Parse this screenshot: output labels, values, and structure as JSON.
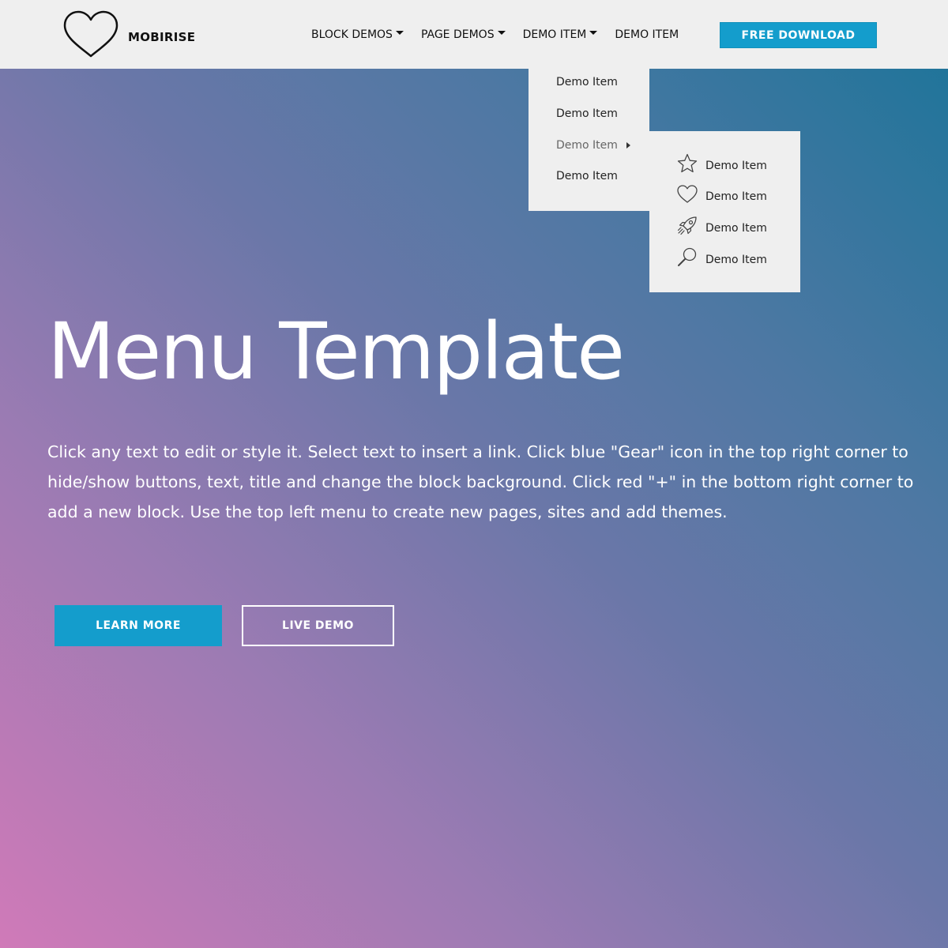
{
  "brand": {
    "name": "MOBIRISE",
    "logo_icon": "heart-icon"
  },
  "nav": {
    "items": [
      {
        "label": "BLOCK DEMOS",
        "has_caret": true
      },
      {
        "label": "PAGE DEMOS",
        "has_caret": true
      },
      {
        "label": "DEMO ITEM",
        "has_caret": true
      },
      {
        "label": "DEMO ITEM",
        "has_caret": false
      }
    ],
    "download_label": "FREE DOWNLOAD"
  },
  "dropdown": {
    "items": [
      {
        "label": "Demo Item"
      },
      {
        "label": "Demo Item"
      },
      {
        "label": "Demo Item",
        "has_submenu": true
      },
      {
        "label": "Demo Item"
      }
    ]
  },
  "submenu": {
    "items": [
      {
        "label": "Demo Item",
        "icon": "star-icon"
      },
      {
        "label": "Demo Item",
        "icon": "heart-icon"
      },
      {
        "label": "Demo Item",
        "icon": "rocket-icon"
      },
      {
        "label": "Demo Item",
        "icon": "search-icon"
      }
    ]
  },
  "hero": {
    "title": "Menu Template",
    "text": "Click any text to edit or style it. Select text to insert a link. Click blue \"Gear\" icon in the top right corner to hide/show buttons, text, title and change the block background. Click red \"+\" in the bottom right corner to add a new block. Use the top left menu to create new pages, sites and add themes.",
    "primary_button": "LEARN MORE",
    "secondary_button": "LIVE DEMO"
  },
  "colors": {
    "accent": "#149dcc",
    "navbar_bg": "#efefef",
    "gradient_start": "#d07ab8",
    "gradient_end": "#1a7499"
  }
}
